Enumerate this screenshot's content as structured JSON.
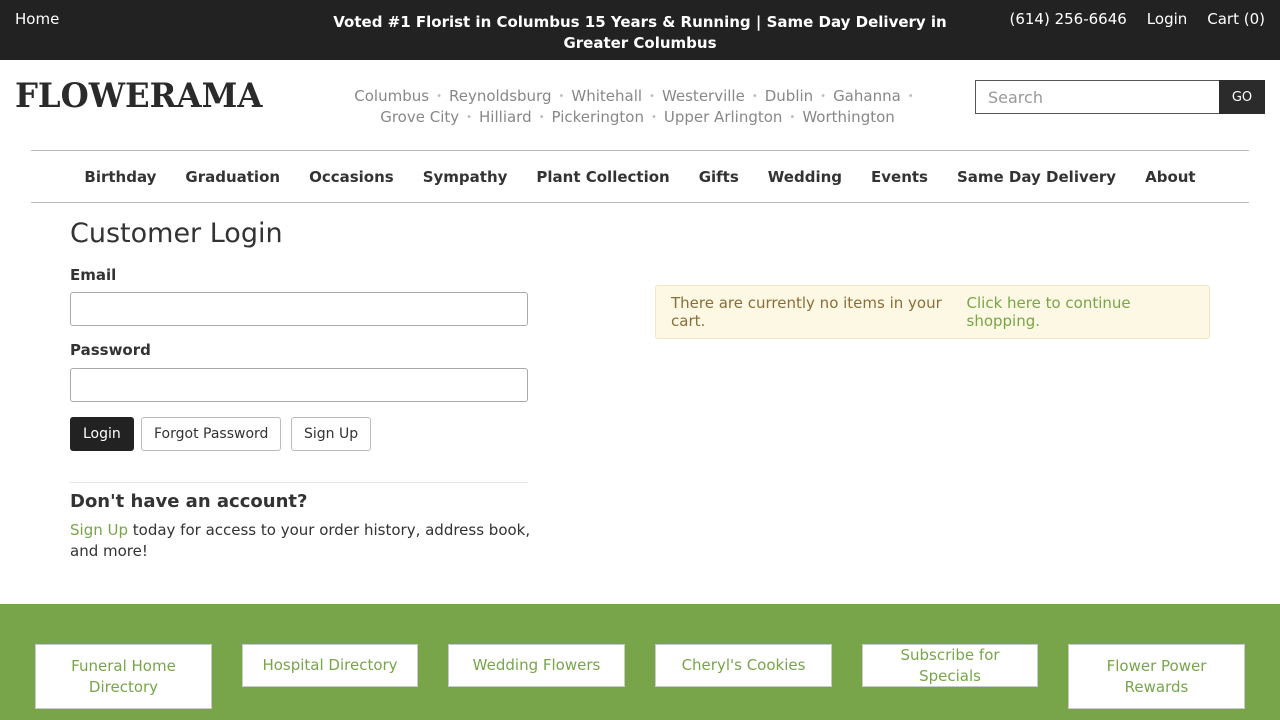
{
  "topbar": {
    "home": "Home",
    "promo": "Voted #1 Florist in Columbus 15 Years & Running | Same Day Delivery in Greater Columbus",
    "phone": "(614) 256-6646",
    "login": "Login",
    "cart": "Cart (0)"
  },
  "header": {
    "logo": "FLOWERAMA",
    "cities_row1": [
      "Columbus",
      "Reynoldsburg",
      "Whitehall",
      "Westerville",
      "Dublin",
      "Gahanna"
    ],
    "cities_row2": [
      "Grove City",
      "Hilliard",
      "Pickerington",
      "Upper Arlington",
      "Worthington"
    ],
    "search": {
      "placeholder": "Search",
      "button": "GO"
    }
  },
  "nav": [
    "Birthday",
    "Graduation",
    "Occasions",
    "Sympathy",
    "Plant Collection",
    "Gifts",
    "Wedding",
    "Events",
    "Same Day Delivery",
    "About"
  ],
  "login": {
    "title": "Customer Login",
    "email_label": "Email",
    "password_label": "Password",
    "login_button": "Login",
    "forgot_button": "Forgot Password",
    "signup_button": "Sign Up",
    "no_account_heading": "Don't have an account?",
    "signup_link": "Sign Up",
    "signup_text": " today for access to your order history, address book, and more!"
  },
  "cart_notice": {
    "text": "There are currently no items in your cart. ",
    "link": "Click here to continue shopping."
  },
  "footer": [
    "Funeral Home Directory",
    "Hospital Directory",
    "Wedding Flowers",
    "Cheryl's Cookies",
    "Subscribe for Specials",
    "Flower Power Rewards"
  ]
}
